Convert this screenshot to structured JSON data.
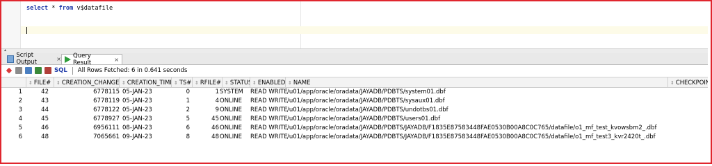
{
  "editor": {
    "kw1": "select",
    "rest1": " * ",
    "kw2": "from",
    "rest2": " v$datafile"
  },
  "tabs": [
    {
      "label": "Script Output",
      "close": "×"
    },
    {
      "label": "Query Result",
      "close": "×"
    }
  ],
  "toolbar": {
    "sql_label": "SQL",
    "status": "All Rows Fetched: 6 in 0.641 seconds"
  },
  "columns": [
    "FILE#",
    "CREATION_CHANGE#",
    "CREATION_TIME",
    "TS#",
    "RFILE#",
    "STATUS",
    "ENABLED",
    "NAME",
    "CHECKPOINT_"
  ],
  "rows": [
    [
      "1",
      "42",
      "6778115",
      "05-JAN-23",
      "0",
      "1",
      "SYSTEM",
      "READ WRITE",
      "/u01/app/oracle/oradata/JAYADB/PDBTS/system01.dbf"
    ],
    [
      "2",
      "43",
      "6778119",
      "05-JAN-23",
      "1",
      "4",
      "ONLINE",
      "READ WRITE",
      "/u01/app/oracle/oradata/JAYADB/PDBTS/sysaux01.dbf"
    ],
    [
      "3",
      "44",
      "6778122",
      "05-JAN-23",
      "2",
      "9",
      "ONLINE",
      "READ WRITE",
      "/u01/app/oracle/oradata/JAYADB/PDBTS/undotbs01.dbf"
    ],
    [
      "4",
      "45",
      "6778927",
      "05-JAN-23",
      "5",
      "45",
      "ONLINE",
      "READ WRITE",
      "/u01/app/oracle/oradata/JAYADB/PDBTS/users01.dbf"
    ],
    [
      "5",
      "46",
      "6956111",
      "08-JAN-23",
      "6",
      "46",
      "ONLINE",
      "READ WRITE",
      "/u01/app/oracle/oradata/JAYADB/PDBTS/JAYADB/F1835E87583448FAE0530B00A8C0C765/datafile/o1_mf_test_kvowsbm2_.dbf"
    ],
    [
      "6",
      "48",
      "7065661",
      "09-JAN-23",
      "8",
      "48",
      "ONLINE",
      "READ WRITE",
      "/u01/app/oracle/oradata/JAYADB/PDBTS/JAYADB/F1835E87583448FAE0530B00A8C0C765/datafile/o1_mf_test3_kvr2420t_.dbf"
    ]
  ],
  "colors": {
    "frame": "#e0262e",
    "keyword": "#1f3aa8"
  }
}
